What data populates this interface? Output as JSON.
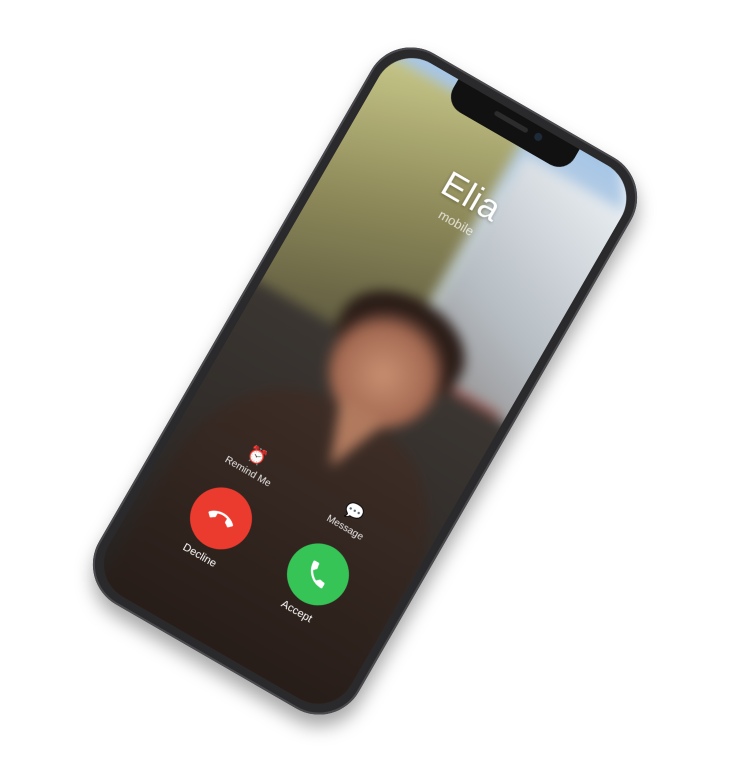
{
  "caller": {
    "name": "Elia",
    "subtitle": "mobile"
  },
  "actions": {
    "remind_label": "Remind Me",
    "message_label": "Message"
  },
  "buttons": {
    "decline_label": "Decline",
    "accept_label": "Accept"
  },
  "colors": {
    "decline": "#eb3b2f",
    "accept": "#36c457"
  },
  "icons": {
    "remind": "alarm-clock-icon",
    "message": "speech-bubble-icon",
    "decline": "phone-hangup-icon",
    "accept": "phone-icon"
  }
}
